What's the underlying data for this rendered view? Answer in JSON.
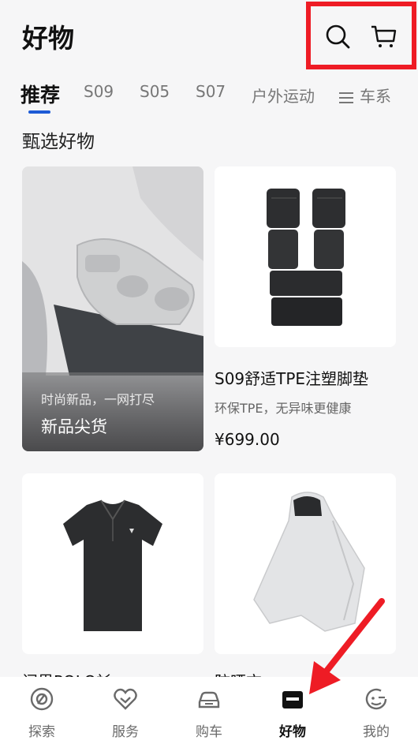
{
  "header": {
    "title": "好物"
  },
  "tabs": [
    {
      "label": "推荐",
      "active": true
    },
    {
      "label": "S09"
    },
    {
      "label": "S05"
    },
    {
      "label": "S07"
    },
    {
      "label": "户外运动"
    },
    {
      "label": "车系"
    }
  ],
  "section_title": "甄选好物",
  "hero_card": {
    "subtitle": "时尚新品，一网打尽",
    "title": "新品尖货"
  },
  "products": [
    {
      "name": "S09舒适TPE注塑脚垫",
      "desc": "环保TPE，无异味更健康",
      "price": "¥699.00"
    }
  ],
  "peek_texts": [
    "问界POLO衫",
    "防晒衣"
  ],
  "bottom_nav": [
    {
      "label": "探索",
      "icon": "explore-icon"
    },
    {
      "label": "服务",
      "icon": "service-icon"
    },
    {
      "label": "购车",
      "icon": "car-icon"
    },
    {
      "label": "好物",
      "icon": "goods-icon",
      "active": true
    },
    {
      "label": "我的",
      "icon": "profile-icon"
    }
  ],
  "colors": {
    "accent": "#1d5bd6",
    "annotation_red": "#ee1c25"
  }
}
